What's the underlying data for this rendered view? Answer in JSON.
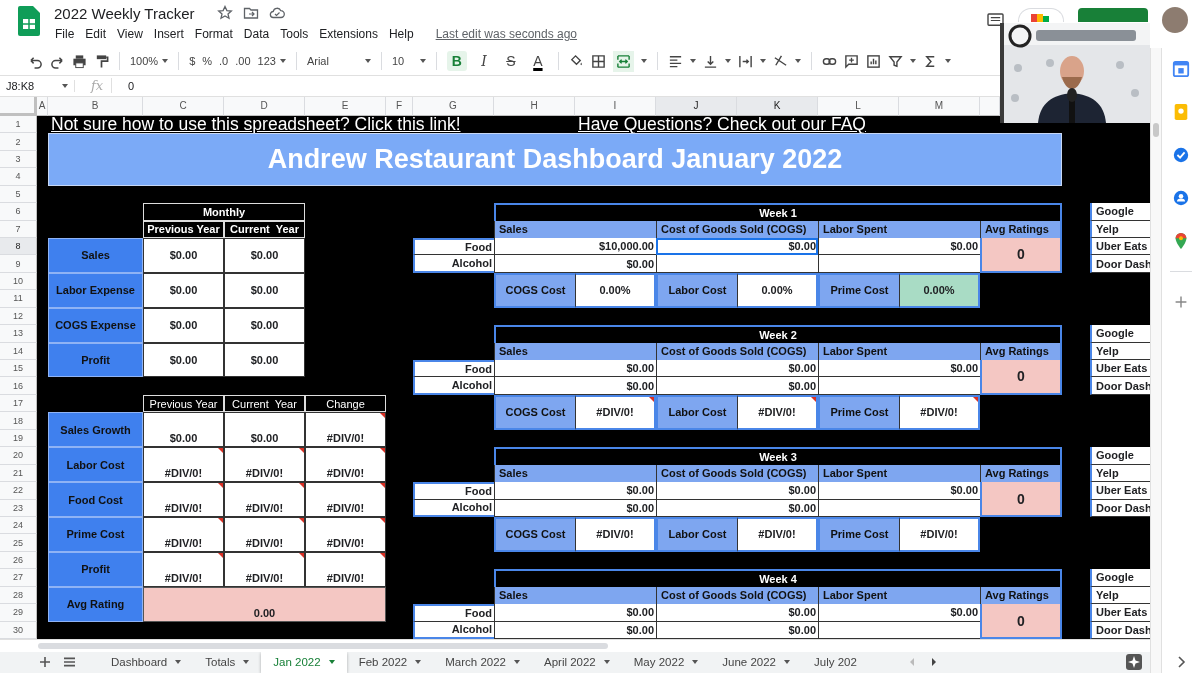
{
  "app": {
    "title": "2022 Weekly Tracker",
    "menu": [
      "File",
      "Edit",
      "View",
      "Insert",
      "Format",
      "Data",
      "Tools",
      "Extensions",
      "Help"
    ],
    "last_edit": "Last edit was seconds ago"
  },
  "toolbar": {
    "zoom": "100%",
    "formats": [
      "$",
      "%",
      ".0",
      ".00",
      "123"
    ],
    "font": "Arial",
    "font_size": "10",
    "styles": [
      {
        "label": "B",
        "kind": "bold",
        "selected": true
      },
      {
        "label": "I",
        "kind": "italic",
        "selected": false
      },
      {
        "label": "S",
        "kind": "strikethrough",
        "selected": false
      },
      {
        "label": "A",
        "kind": "text-color",
        "selected": false
      }
    ]
  },
  "formula_bar": {
    "cell_range": "J8:K8",
    "fx": "fx",
    "value": "0"
  },
  "columns": [
    {
      "label": "A",
      "selected": false
    },
    {
      "label": "B",
      "selected": false
    },
    {
      "label": "C",
      "selected": false
    },
    {
      "label": "D",
      "selected": false
    },
    {
      "label": "E",
      "selected": false
    },
    {
      "label": "F",
      "selected": false
    },
    {
      "label": "G",
      "selected": false
    },
    {
      "label": "H",
      "selected": false
    },
    {
      "label": "I",
      "selected": false
    },
    {
      "label": "J",
      "selected": true
    },
    {
      "label": "K",
      "selected": true
    },
    {
      "label": "L",
      "selected": false
    },
    {
      "label": "M",
      "selected": false
    }
  ],
  "rows": [
    {
      "label": "1",
      "selected": false
    },
    {
      "label": "2",
      "selected": false
    },
    {
      "label": "3",
      "selected": false
    },
    {
      "label": "4",
      "selected": false
    },
    {
      "label": "5",
      "selected": false
    },
    {
      "label": "6",
      "selected": false
    },
    {
      "label": "7",
      "selected": false
    },
    {
      "label": "8",
      "selected": true
    },
    {
      "label": "9",
      "selected": false
    },
    {
      "label": "10",
      "selected": false
    },
    {
      "label": "11",
      "selected": false
    },
    {
      "label": "12",
      "selected": false
    },
    {
      "label": "13",
      "selected": false
    },
    {
      "label": "14",
      "selected": false
    },
    {
      "label": "15",
      "selected": false
    },
    {
      "label": "16",
      "selected": false
    },
    {
      "label": "17",
      "selected": false
    },
    {
      "label": "18",
      "selected": false
    },
    {
      "label": "19",
      "selected": false
    },
    {
      "label": "20",
      "selected": false
    },
    {
      "label": "21",
      "selected": false
    },
    {
      "label": "22",
      "selected": false
    },
    {
      "label": "23",
      "selected": false
    },
    {
      "label": "24",
      "selected": false
    },
    {
      "label": "25",
      "selected": false
    },
    {
      "label": "26",
      "selected": false
    },
    {
      "label": "27",
      "selected": false
    },
    {
      "label": "28",
      "selected": false
    },
    {
      "label": "29",
      "selected": false
    },
    {
      "label": "30",
      "selected": false
    }
  ],
  "sheet": {
    "links": [
      "Not sure how to use this spreadsheet? Click this link!",
      "Have Questions? Check out our FAQ"
    ],
    "title": "Andrew Restaurant Dashboard January 2022",
    "monthly": {
      "heading": "Monthly",
      "columns": [
        "Previous Year",
        "Current  Year"
      ],
      "rows": [
        {
          "label": "Sales",
          "values": [
            "$0.00",
            "$0.00"
          ]
        },
        {
          "label": "Labor Expense",
          "values": [
            "$0.00",
            "$0.00"
          ]
        },
        {
          "label": "COGS Expense",
          "values": [
            "$0.00",
            "$0.00"
          ]
        },
        {
          "label": "Profit",
          "values": [
            "$0.00",
            "$0.00"
          ]
        }
      ]
    },
    "metrics": {
      "columns": [
        "Previous Year",
        "Current  Year",
        "Change"
      ],
      "rows": [
        {
          "label": "Sales Growth",
          "values": [
            {
              "text": "$0.00",
              "error": false
            },
            {
              "text": "$0.00",
              "error": false
            },
            {
              "text": "#DIV/0!",
              "error": true
            }
          ]
        },
        {
          "label": "Labor Cost",
          "values": [
            {
              "text": "#DIV/0!",
              "error": true
            },
            {
              "text": "#DIV/0!",
              "error": true
            },
            {
              "text": "#DIV/0!",
              "error": true
            }
          ]
        },
        {
          "label": "Food Cost",
          "values": [
            {
              "text": "#DIV/0!",
              "error": true
            },
            {
              "text": "#DIV/0!",
              "error": true
            },
            {
              "text": "#DIV/0!",
              "error": true
            }
          ]
        },
        {
          "label": "Prime Cost",
          "values": [
            {
              "text": "#DIV/0!",
              "error": true
            },
            {
              "text": "#DIV/0!",
              "error": true
            },
            {
              "text": "#DIV/0!",
              "error": true
            }
          ]
        },
        {
          "label": "Profit",
          "values": [
            {
              "text": "#DIV/0!",
              "error": true
            },
            {
              "text": "#DIV/0!",
              "error": true
            },
            {
              "text": "#DIV/0!",
              "error": true
            }
          ]
        }
      ],
      "avg_rating": {
        "label": "Avg Rating",
        "value": "0.00"
      }
    },
    "weeks": [
      {
        "title": "Week 1",
        "columns": [
          "Sales",
          "Cost of Goods Sold (COGS)",
          "Labor Spent",
          "Avg Ratings"
        ],
        "rows": [
          {
            "label": "Food",
            "cells": [
              {
                "text": "$10,000.00",
                "selected": false
              },
              {
                "text": "$0.00",
                "selected": true
              },
              {
                "text": "$0.00",
                "selected": false
              }
            ]
          },
          {
            "label": "Alcohol",
            "cells": [
              {
                "text": "$0.00",
                "selected": false
              },
              {
                "selected": false
              },
              {
                "selected": false
              }
            ]
          }
        ],
        "rating": "0",
        "costs": [
          {
            "label": "COGS Cost",
            "value": "0.00%",
            "highlighted": false,
            "error": false
          },
          {
            "label": "Labor Cost",
            "value": "0.00%",
            "highlighted": false,
            "error": false
          },
          {
            "label": "Prime Cost",
            "value": "0.00%",
            "highlighted": true,
            "error": false
          }
        ],
        "sources": [
          "Google",
          "Yelp",
          "Uber Eats",
          "Door Dash"
        ]
      },
      {
        "title": "Week 2",
        "columns": [
          "Sales",
          "Cost of Goods Sold (COGS)",
          "Labor Spent",
          "Avg Ratings"
        ],
        "rows": [
          {
            "label": "Food",
            "cells": [
              {
                "text": "$0.00",
                "selected": false
              },
              {
                "text": "$0.00",
                "selected": false
              },
              {
                "text": "$0.00",
                "selected": false
              }
            ]
          },
          {
            "label": "Alcohol",
            "cells": [
              {
                "text": "$0.00",
                "selected": false
              },
              {
                "text": "$0.00",
                "selected": false
              },
              {
                "selected": false
              }
            ]
          }
        ],
        "rating": "0",
        "costs": [
          {
            "label": "COGS Cost",
            "value": "#DIV/0!",
            "highlighted": false,
            "error": true
          },
          {
            "label": "Labor Cost",
            "value": "#DIV/0!",
            "highlighted": false,
            "error": true
          },
          {
            "label": "Prime Cost",
            "value": "#DIV/0!",
            "highlighted": false,
            "error": true
          }
        ],
        "sources": [
          "Google",
          "Yelp",
          "Uber Eats",
          "Door Dash"
        ]
      },
      {
        "title": "Week 3",
        "columns": [
          "Sales",
          "Cost of Goods Sold (COGS)",
          "Labor Spent",
          "Avg Ratings"
        ],
        "rows": [
          {
            "label": "Food",
            "cells": [
              {
                "text": "$0.00",
                "selected": false
              },
              {
                "text": "$0.00",
                "selected": false
              },
              {
                "text": "$0.00",
                "selected": false
              }
            ]
          },
          {
            "label": "Alcohol",
            "cells": [
              {
                "text": "$0.00",
                "selected": false
              },
              {
                "text": "$0.00",
                "selected": false
              },
              {
                "selected": false
              }
            ]
          }
        ],
        "rating": "0",
        "costs": [
          {
            "label": "COGS Cost",
            "value": "#DIV/0!",
            "highlighted": false,
            "error": false
          },
          {
            "label": "Labor Cost",
            "value": "#DIV/0!",
            "highlighted": false,
            "error": false
          },
          {
            "label": "Prime Cost",
            "value": "#DIV/0!",
            "highlighted": false,
            "error": false
          }
        ],
        "sources": [
          "Google",
          "Yelp",
          "Uber Eats",
          "Door Dash"
        ]
      },
      {
        "title": "Week 4",
        "columns": [
          "Sales",
          "Cost of Goods Sold (COGS)",
          "Labor Spent",
          "Avg Ratings"
        ],
        "rows": [
          {
            "label": "Food",
            "cells": [
              {
                "text": "$0.00",
                "selected": false
              },
              {
                "text": "$0.00",
                "selected": false
              },
              {
                "text": "$0.00",
                "selected": false
              }
            ]
          },
          {
            "label": "Alcohol",
            "cells": [
              {
                "text": "$0.00",
                "selected": false
              },
              {
                "text": "$0.00",
                "selected": false
              },
              {
                "selected": false
              }
            ]
          }
        ],
        "rating": "0",
        "sources": [
          "Google",
          "Yelp",
          "Uber Eats",
          "Door Dash"
        ]
      }
    ]
  },
  "tabs": [
    {
      "label": "Dashboard",
      "selected": false
    },
    {
      "label": "Totals",
      "selected": false
    },
    {
      "label": "Jan 2022",
      "selected": true
    },
    {
      "label": "Feb 2022",
      "selected": false
    },
    {
      "label": "March 2022",
      "selected": false
    },
    {
      "label": "April 2022",
      "selected": false
    },
    {
      "label": "May 2022",
      "selected": false
    },
    {
      "label": "June 2022",
      "selected": false
    },
    {
      "label": "July 202",
      "selected": false
    }
  ]
}
